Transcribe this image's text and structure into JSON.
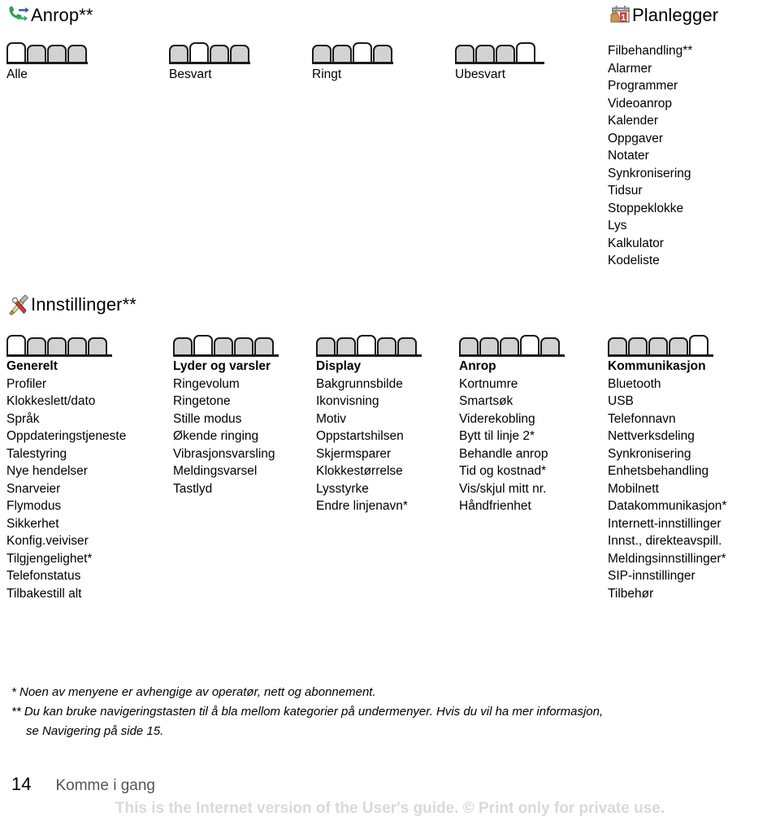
{
  "page": {
    "number": "14",
    "chapter": "Komme i gang",
    "watermark": "This is the Internet version of the User's guide. © Print only for private use."
  },
  "sections": {
    "anrop": {
      "icon": "call-log-icon",
      "title": "Anrop**",
      "tabs": [
        {
          "label": "Alle",
          "count": 4,
          "active_index": 0
        },
        {
          "label": "Besvart",
          "count": 4,
          "active_index": 1
        },
        {
          "label": "Ringt",
          "count": 4,
          "active_index": 2
        },
        {
          "label": "Ubesvart",
          "count": 4,
          "active_index": 3
        }
      ]
    },
    "planlegger": {
      "icon": "calendar-organizer-icon",
      "title": "Planlegger",
      "items": [
        "Filbehandling**",
        "Alarmer",
        "Programmer",
        "Videoanrop",
        "Kalender",
        "Oppgaver",
        "Notater",
        "Synkronisering",
        "Tidsur",
        "Stoppeklokke",
        "Lys",
        "Kalkulator",
        "Kodeliste"
      ]
    },
    "innstillinger": {
      "icon": "tools-settings-icon",
      "title": "Innstillinger**",
      "columns": [
        {
          "tab": {
            "count": 5,
            "active_index": 0
          },
          "heading": "Generelt",
          "items": [
            "Profiler",
            "Klokkeslett/dato",
            "Språk",
            "Oppdateringstjeneste",
            "Talestyring",
            "Nye hendelser",
            "Snarveier",
            "Flymodus",
            "Sikkerhet",
            "Konfig.veiviser",
            "Tilgjengelighet*",
            "Telefonstatus",
            "Tilbakestill alt"
          ]
        },
        {
          "tab": {
            "count": 5,
            "active_index": 1
          },
          "heading": "Lyder og varsler",
          "items": [
            "Ringevolum",
            "Ringetone",
            "Stille modus",
            "Økende ringing",
            "Vibrasjonsvarsling",
            "Meldingsvarsel",
            "Tastlyd"
          ]
        },
        {
          "tab": {
            "count": 5,
            "active_index": 2
          },
          "heading": "Display",
          "items": [
            "Bakgrunnsbilde",
            "Ikonvisning",
            "Motiv",
            "Oppstartshilsen",
            "Skjermsparer",
            "Klokkestørrelse",
            "Lysstyrke",
            "Endre linjenavn*"
          ]
        },
        {
          "tab": {
            "count": 5,
            "active_index": 3
          },
          "heading": "Anrop",
          "items": [
            "Kortnumre",
            "Smartsøk",
            "Viderekobling",
            "Bytt til linje 2*",
            "Behandle anrop",
            "Tid og kostnad*",
            "Vis/skjul mitt nr.",
            "Håndfrienhet"
          ]
        },
        {
          "tab": {
            "count": 5,
            "active_index": 4
          },
          "heading": "Kommunikasjon",
          "items": [
            "Bluetooth",
            "USB",
            "Telefonnavn",
            "Nettverksdeling",
            "Synkronisering",
            "Enhetsbehandling",
            "Mobilnett",
            "Datakommunikasjon*",
            "Internett-innstillinger",
            "Innst., direkteavspill.",
            "Meldingsinnstillinger*",
            "SIP-innstillinger",
            "Tilbehør"
          ]
        }
      ]
    }
  },
  "footnotes": [
    "* Noen av menyene er avhengige av operatør, nett og abonnement.",
    "** Du kan bruke navigeringstasten til å bla mellom kategorier på undermenyer. Hvis du vil ha mer informasjon,",
    "se Navigering på side 15."
  ],
  "colors": {
    "tab_fill": "#d2d2d2",
    "tab_active_fill": "#ffffff",
    "tab_stroke": "#1b1b1b",
    "watermark": "#d9d9d9",
    "chapter": "#555555"
  }
}
